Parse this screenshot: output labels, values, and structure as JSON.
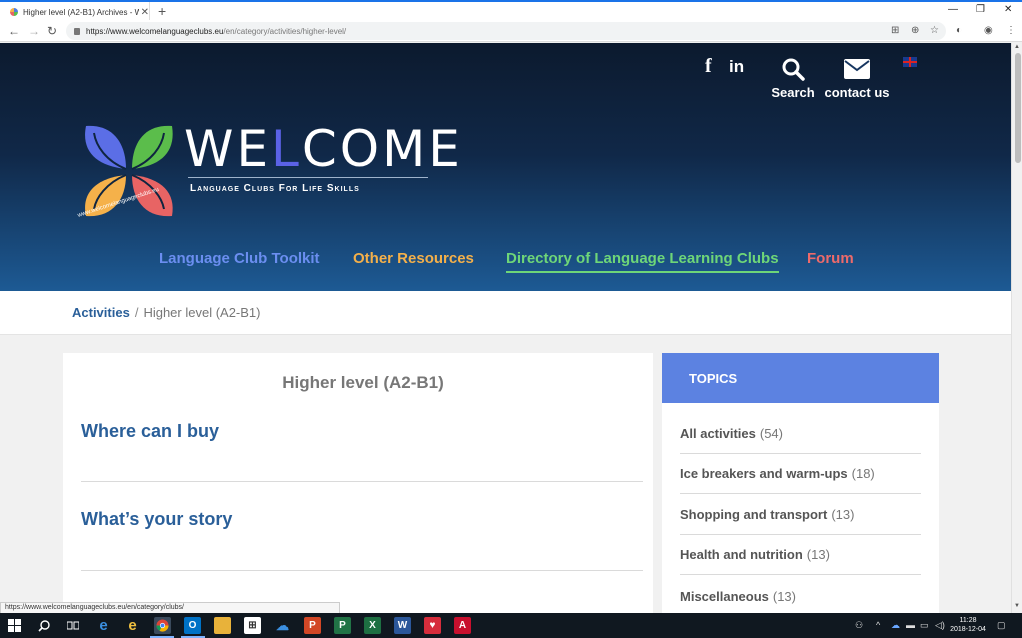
{
  "browser": {
    "tab_title": "Higher level (A2-B1) Archives - W",
    "url_host": "https://www.welcomelanguageclubs.eu",
    "url_path": "/en/category/activities/higher-level/",
    "status_url": "https://www.welcomelanguageclubs.eu/en/category/clubs/"
  },
  "header": {
    "search_label": "Search",
    "contact_label": "contact us"
  },
  "logo": {
    "word_start": "WE",
    "word_highlight": "L",
    "word_end": "COME",
    "subtitle": "Language Clubs For Life Skills",
    "url": "www.welcomelanguageclubs.eu"
  },
  "nav": [
    {
      "label": "Language Club Toolkit",
      "color": "#6b8ef0"
    },
    {
      "label": "Other Resources",
      "color": "#f4b04a"
    },
    {
      "label": "Directory of Language Learning Clubs",
      "color": "#6ed678"
    },
    {
      "label": "Forum",
      "color": "#ee6a6a"
    }
  ],
  "breadcrumb": {
    "parent": "Activities",
    "separator": "/",
    "current": "Higher level (A2-B1)"
  },
  "main": {
    "page_title": "Higher level (A2-B1)",
    "posts": [
      "Where can I buy",
      "What’s your story"
    ]
  },
  "sidebar": {
    "heading": "TOPICS",
    "topics": [
      {
        "name": "All activities",
        "count": "(54)"
      },
      {
        "name": "Ice breakers and warm-ups",
        "count": "(18)"
      },
      {
        "name": "Shopping and transport",
        "count": "(13)"
      },
      {
        "name": "Health and nutrition",
        "count": "(13)"
      },
      {
        "name": "Miscellaneous",
        "count": "(13)"
      }
    ]
  },
  "taskbar": {
    "time": "11:28",
    "date": "2018-12-04"
  }
}
